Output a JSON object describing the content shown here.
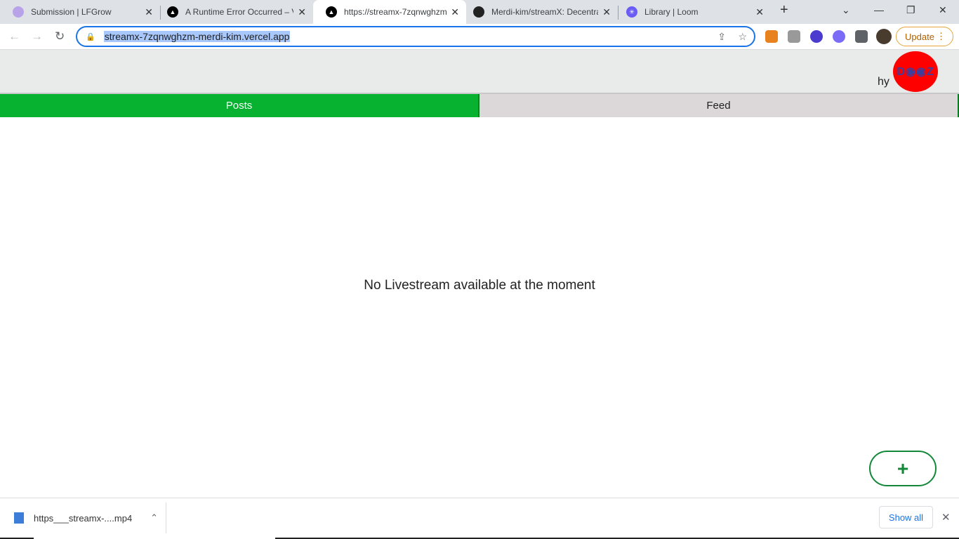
{
  "browser": {
    "tabs": [
      {
        "title": "Submission | LFGrow",
        "icon": "lfgrow-icon"
      },
      {
        "title": "A Runtime Error Occurred – V",
        "icon": "vercel-icon"
      },
      {
        "title": "https://streamx-7zqnwghzm-",
        "icon": "vercel-icon"
      },
      {
        "title": "Merdi-kim/streamX: Decentra",
        "icon": "github-icon"
      },
      {
        "title": "Library | Loom",
        "icon": "loom-icon"
      }
    ],
    "url": "streamx-7zqnwghzm-merdi-kim.vercel.app",
    "update_label": "Update"
  },
  "header": {
    "greeting": "hy",
    "avatar_text": "D◉◉Z"
  },
  "nav": {
    "tabs": [
      {
        "label": "Posts",
        "active": true
      },
      {
        "label": "Feed",
        "active": false
      }
    ]
  },
  "main": {
    "empty_message": "No Livestream available at the moment",
    "fab_label": "+"
  },
  "downloads": {
    "file": "https___streamx-....mp4",
    "show_all": "Show all"
  },
  "colors": {
    "accent": "#06b22f",
    "avatar": "#ff0000"
  }
}
